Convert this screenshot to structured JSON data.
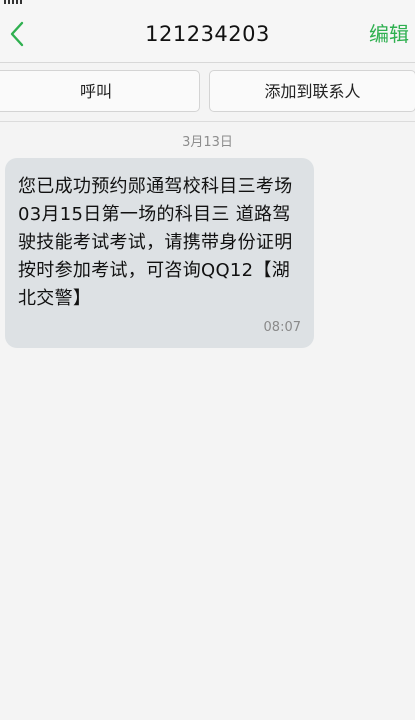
{
  "header": {
    "title": "121234203",
    "edit_label": "编辑"
  },
  "actions": {
    "call_label": "呼叫",
    "add_contact_label": "添加到联系人"
  },
  "conversation": {
    "date_separator": "3月13日",
    "messages": [
      {
        "text": "您已成功预约郧通驾校科目三考场03月15日第一场的科目三 道路驾驶技能考试考试，请携带身份证明按时参加考试，可咨询QQ12【湖北交警】",
        "time": "08:07"
      }
    ]
  },
  "colors": {
    "accent": "#2fb050",
    "bubble_background": "#dde1e4",
    "background": "#f4f4f4"
  },
  "icons": {
    "back": "chevron-left-icon"
  }
}
